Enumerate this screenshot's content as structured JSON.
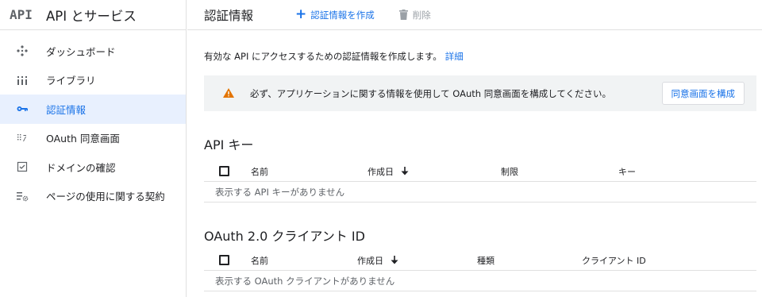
{
  "brand": {
    "logo_text": "API",
    "title": "API とサービス"
  },
  "sidebar": {
    "items": [
      {
        "label": "ダッシュボード",
        "icon": "dashboard-icon",
        "active": false
      },
      {
        "label": "ライブラリ",
        "icon": "library-icon",
        "active": false
      },
      {
        "label": "認証情報",
        "icon": "key-icon",
        "active": true
      },
      {
        "label": "OAuth 同意画面",
        "icon": "consent-screen-icon",
        "active": false
      },
      {
        "label": "ドメインの確認",
        "icon": "domain-verify-icon",
        "active": false
      },
      {
        "label": "ページの使用に関する契約",
        "icon": "page-settings-icon",
        "active": false
      }
    ]
  },
  "header": {
    "title": "認証情報",
    "create_label": "認証情報を作成",
    "delete_label": "削除"
  },
  "main": {
    "intro_text": "有効な API にアクセスするための認証情報を作成します。",
    "intro_link": "詳細",
    "banner": {
      "message": "必ず、アプリケーションに関する情報を使用して OAuth 同意画面を構成してください。",
      "button_label": "同意画面を構成"
    },
    "api_keys": {
      "title": "API キー",
      "columns": [
        "名前",
        "作成日",
        "制限",
        "キー"
      ],
      "empty_text": "表示する API キーがありません"
    },
    "oauth": {
      "title": "OAuth 2.0 クライアント ID",
      "columns": [
        "名前",
        "作成日",
        "種類",
        "クライアント ID"
      ],
      "empty_text": "表示する OAuth クライアントがありません"
    }
  },
  "colors": {
    "accent": "#1a73e8",
    "active_bg": "#e8f0fe",
    "warning": "#e37400",
    "banner_bg": "#f1f3f4"
  }
}
